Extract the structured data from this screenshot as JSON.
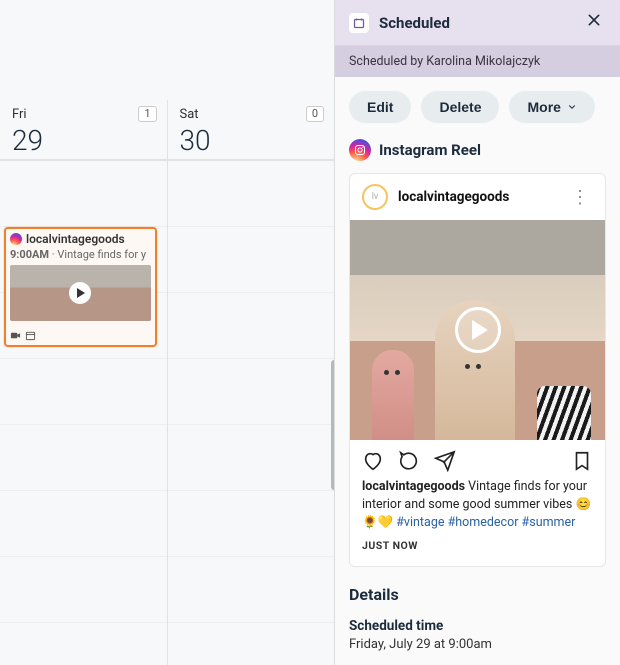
{
  "calendar": {
    "days": [
      {
        "dow": "Fri",
        "num": "29",
        "count": "1"
      },
      {
        "dow": "Sat",
        "num": "30",
        "count": "0"
      }
    ],
    "event": {
      "account": "localvintagegoods",
      "time": "9:00AM",
      "snippet": "Vintage finds for y"
    }
  },
  "panel": {
    "title": "Scheduled",
    "subtitle": "Scheduled by Karolina Mikolajczyk",
    "buttons": {
      "edit": "Edit",
      "delete": "Delete",
      "more": "More"
    },
    "post_type": "Instagram Reel",
    "preview": {
      "username": "localvintagegoods",
      "caption_user": "localvintagegoods",
      "caption_text": "Vintage finds for your interior and some good summer vibes 😊🌻💛 ",
      "hashtags": "#vintage #homedecor #summer",
      "timestamp": "JUST NOW"
    },
    "details": {
      "heading": "Details",
      "scheduled_label": "Scheduled time",
      "scheduled_value": "Friday, July 29 at 9:00am"
    }
  }
}
